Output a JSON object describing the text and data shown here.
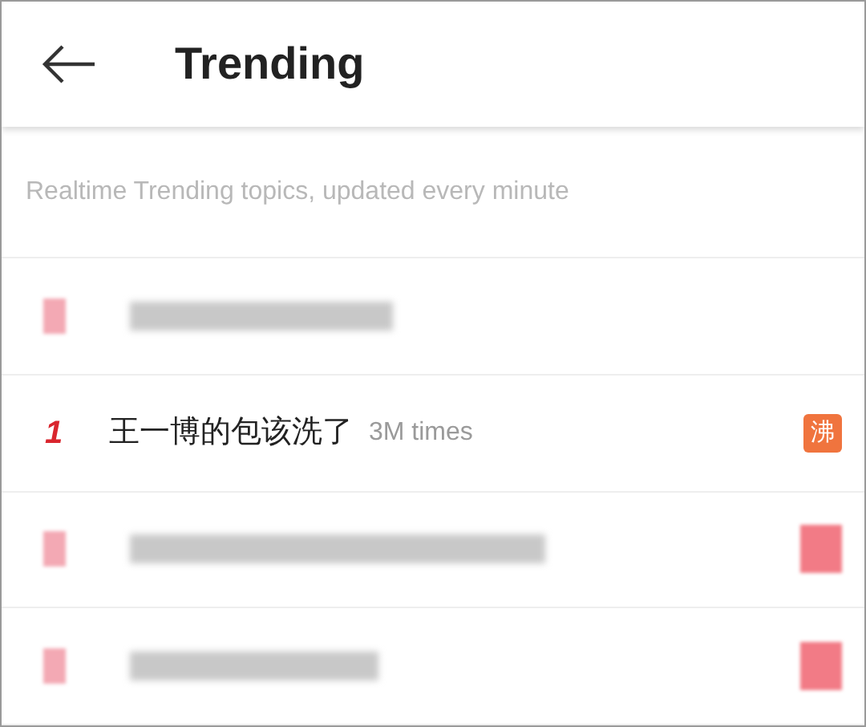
{
  "header": {
    "title": "Trending"
  },
  "subtitle": "Realtime Trending topics, updated every minute",
  "topics": [
    {
      "kind": "redacted",
      "has_badge": false
    },
    {
      "kind": "topic",
      "rank": "1",
      "title": "王一博的包该洗了",
      "count": "3M times",
      "badge": "沸"
    },
    {
      "kind": "redacted",
      "has_badge": true
    },
    {
      "kind": "redacted",
      "has_badge": true
    }
  ]
}
